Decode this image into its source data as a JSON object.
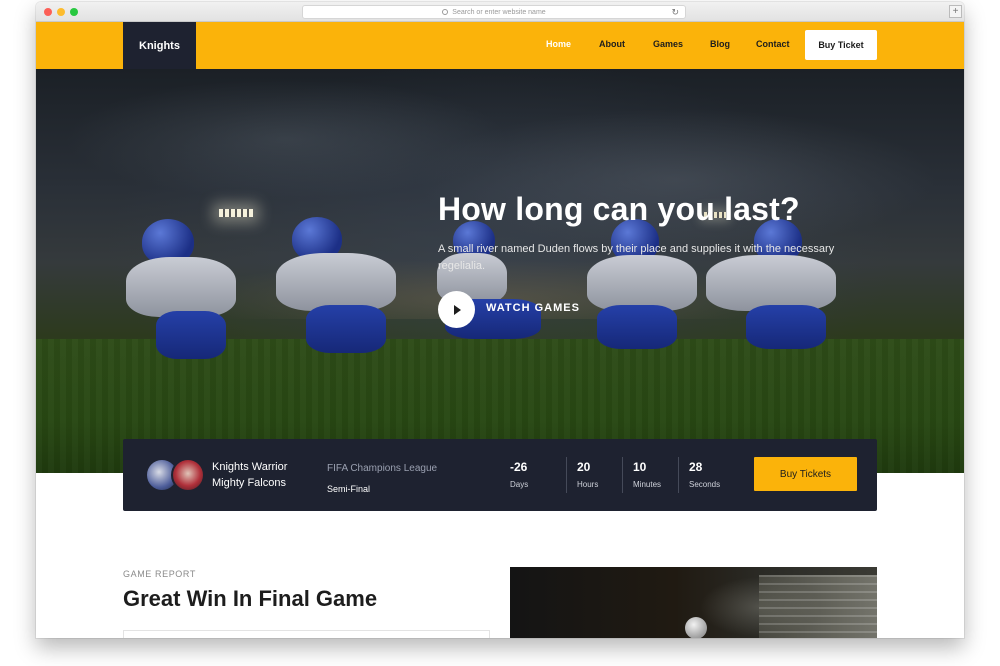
{
  "browser": {
    "address_placeholder": "Search or enter website name"
  },
  "nav": {
    "brand": "Knights",
    "links": [
      "Home",
      "About",
      "Games",
      "Blog",
      "Contact"
    ],
    "active_link": "Home",
    "buy_ticket": "Buy Ticket"
  },
  "hero": {
    "title": "How long can you last?",
    "subtitle": "A small river named Duden flows by their place and supplies it with the necessary regelialia.",
    "watch_label": "WATCH GAMES"
  },
  "match": {
    "team_home": "Knights Warrior",
    "team_away": "Mighty Falcons",
    "league": "FIFA Champions League",
    "round": "Semi-Final",
    "countdown": [
      {
        "value": "-26",
        "unit": "Days"
      },
      {
        "value": "20",
        "unit": "Hours"
      },
      {
        "value": "10",
        "unit": "Minutes"
      },
      {
        "value": "28",
        "unit": "Seconds"
      }
    ],
    "buy_tickets": "Buy Tickets"
  },
  "report": {
    "eyebrow": "GAME REPORT",
    "title": "Great Win In Final Game"
  },
  "colors": {
    "accent": "#fbb30a",
    "dark": "#1e2230"
  },
  "icons": {
    "play": "play-icon",
    "reload": "reload-icon",
    "new_tab": "plus-icon"
  }
}
